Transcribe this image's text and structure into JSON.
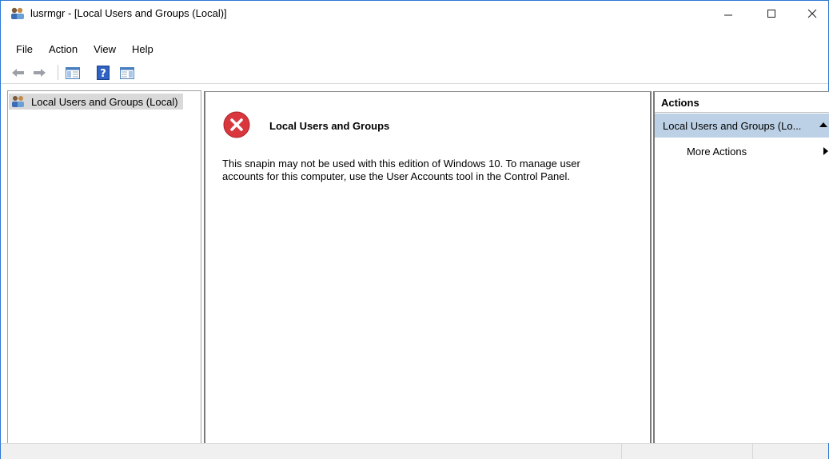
{
  "window": {
    "title": "lusrmgr - [Local Users and Groups (Local)]"
  },
  "menu": [
    "File",
    "Action",
    "View",
    "Help"
  ],
  "toolbar": {
    "buttons": [
      "back-arrow-icon",
      "forward-arrow-icon",
      "show-hide-console-tree-icon",
      "help-icon",
      "show-hide-action-pane-icon"
    ]
  },
  "tree": {
    "root_label": "Local Users and Groups (Local)"
  },
  "message": {
    "title": "Local Users and Groups",
    "body": "This snapin may not be used with this edition of Windows 10. To manage user accounts for this computer, use the User Accounts tool in the Control Panel."
  },
  "actions": {
    "header": "Actions",
    "section_label": "Local Users and Groups (Lo...",
    "more_actions": "More Actions"
  },
  "colors": {
    "window_border": "#2b78d4",
    "actions_section_bg": "#bcd1e6",
    "error_red": "#d9363e"
  }
}
